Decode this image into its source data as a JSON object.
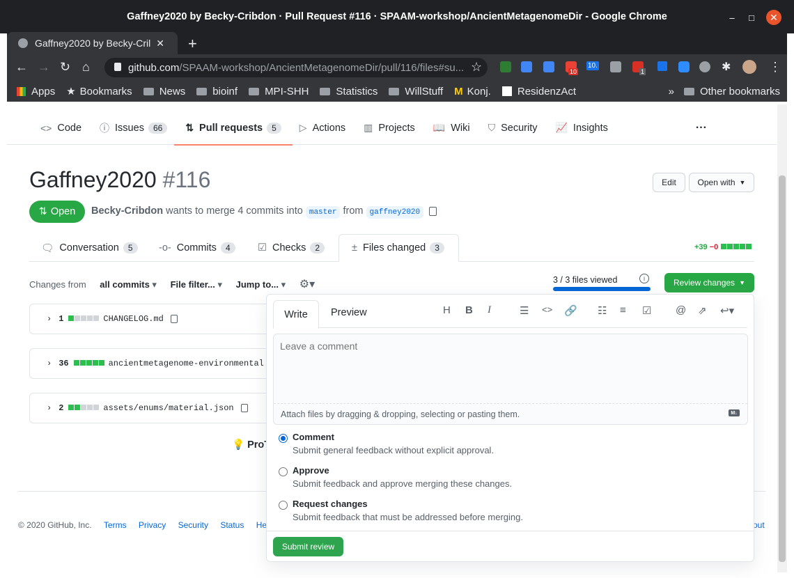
{
  "window": {
    "title": "Gaffney2020 by Becky-Cribdon · Pull Request #116 · SPAAM-workshop/AncientMetagenomeDir - Google Chrome",
    "minimize": "–",
    "maximize": "□",
    "close": "✕"
  },
  "tab": {
    "title": "Gaffney2020 by Becky-Cril",
    "new_tab": "+"
  },
  "omnibox": {
    "host": "github.com",
    "path": "/SPAAM-workshop/AncientMetagenomeDir/pull/116/files#su..."
  },
  "extension_badges": {
    "gmail": "10",
    "calendar": "10.",
    "tasks": "1"
  },
  "bookmarks": {
    "apps": "Apps",
    "items": [
      "Bookmarks",
      "News",
      "bioinf",
      "MPI-SHH",
      "Statistics",
      "WillStuff",
      "Konj.",
      "ResidenzAct"
    ],
    "overflow": "»",
    "other": "Other bookmarks"
  },
  "repo_nav": {
    "code": "Code",
    "issues": "Issues",
    "issues_count": "66",
    "pulls": "Pull requests",
    "pulls_count": "5",
    "actions": "Actions",
    "projects": "Projects",
    "wiki": "Wiki",
    "security": "Security",
    "insights": "Insights",
    "more": "···"
  },
  "pr": {
    "title": "Gaffney2020",
    "number": "#116",
    "edit": "Edit",
    "open_with": "Open with",
    "state": "Open",
    "author": "Becky-Cribdon",
    "merge_text": "wants to merge 4 commits into",
    "base": "master",
    "from": "from",
    "head": "gaffney2020"
  },
  "pr_tabs": {
    "conversation": "Conversation",
    "conversation_count": "5",
    "commits": "Commits",
    "commits_count": "4",
    "checks": "Checks",
    "checks_count": "2",
    "files": "Files changed",
    "files_count": "3"
  },
  "diffstat": {
    "add": "+39",
    "del": "−0",
    "blocks": {
      "green": 5,
      "gray": 0
    }
  },
  "files_toolbar": {
    "changes_from": "Changes from",
    "all_commits": "all commits",
    "file_filter": "File filter...",
    "jump_to": "Jump to...",
    "viewed": "3 / 3 files viewed",
    "viewed_fraction": 1.0,
    "review_changes": "Review changes"
  },
  "files": [
    {
      "count": "1",
      "name": "CHANGELOG.md",
      "blocks": {
        "green": 1,
        "gray": 4
      }
    },
    {
      "count": "36",
      "name": "ancientmetagenome-environmental",
      "blocks": {
        "green": 5,
        "gray": 0
      }
    },
    {
      "count": "2",
      "name": "assets/enums/material.json",
      "blocks": {
        "green": 2,
        "gray": 3
      }
    }
  ],
  "protip": "ProT",
  "footer": {
    "copyright": "© 2020 GitHub, Inc.",
    "links": [
      "Terms",
      "Privacy",
      "Security",
      "Status",
      "Help"
    ],
    "about": "out"
  },
  "review": {
    "write": "Write",
    "preview": "Preview",
    "placeholder": "Leave a comment",
    "attach": "Attach files by dragging & dropping, selecting or pasting them.",
    "options": [
      {
        "label": "Comment",
        "desc": "Submit general feedback without explicit approval.",
        "checked": true
      },
      {
        "label": "Approve",
        "desc": "Submit feedback and approve merging these changes.",
        "checked": false
      },
      {
        "label": "Request changes",
        "desc": "Submit feedback that must be addressed before merging.",
        "checked": false
      }
    ],
    "submit": "Submit review"
  }
}
